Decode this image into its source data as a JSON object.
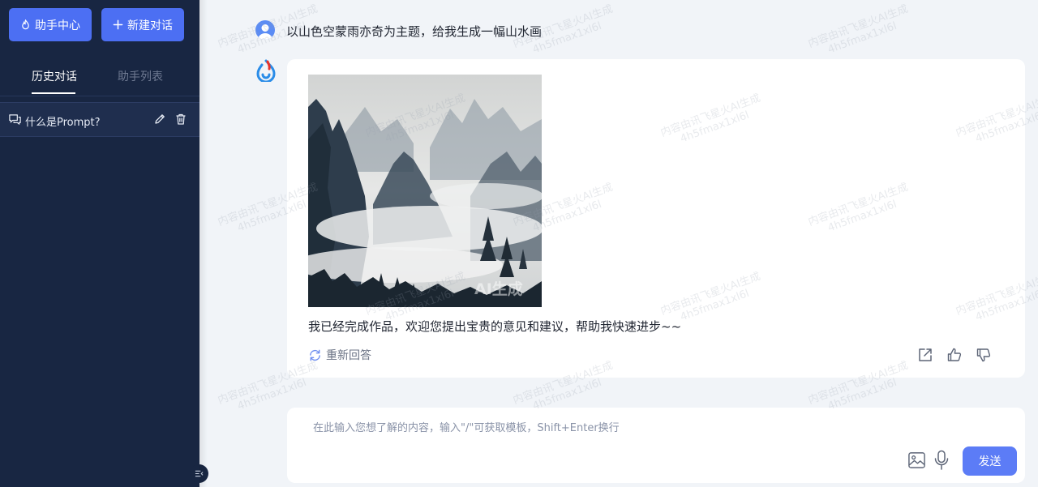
{
  "sidebar": {
    "assistant_center_label": "助手中心",
    "new_chat_label": "新建对话",
    "tabs": [
      {
        "label": "历史对话",
        "active": true
      },
      {
        "label": "助手列表",
        "active": false
      }
    ],
    "conversations": [
      {
        "title": "什么是Prompt?"
      }
    ]
  },
  "chat": {
    "user_message": "以山色空蒙雨亦奇为主题，给我生成一幅山水画",
    "bot_image_badge": "AI生成",
    "bot_answer": "我已经完成作品，欢迎您提出宝贵的意见和建议，帮助我快速进步~~",
    "regenerate_label": "重新回答"
  },
  "input": {
    "placeholder": "在此输入您想了解的内容，输入\"/\"可获取模板，Shift+Enter换行",
    "send_label": "发送"
  },
  "watermark": {
    "line1": "内容由讯飞星火AI生成",
    "line2": "4h5fmax1xl6l"
  },
  "colors": {
    "sidebar_bg": "#182642",
    "accent": "#4c6ff3",
    "send_button": "#5c7cf6",
    "page_bg": "#f1f4f8"
  }
}
